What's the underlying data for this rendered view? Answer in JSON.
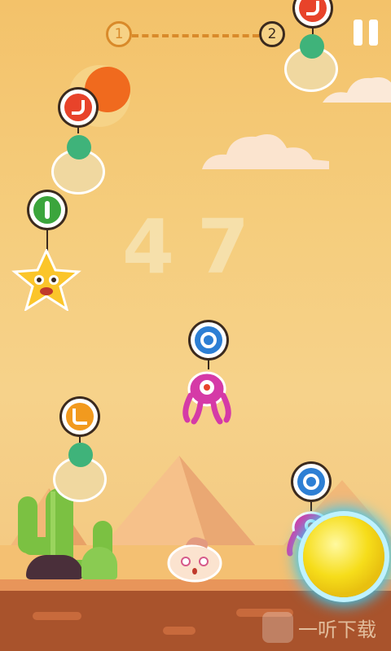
{
  "level_progress": {
    "from": "1",
    "to": "2"
  },
  "score": "47",
  "controls": {
    "pause": "pause"
  },
  "watermark": {
    "text": "一听下载"
  },
  "characters": [
    {
      "name": "frog-egg",
      "gesture_color": "#e8432a"
    },
    {
      "name": "frog-egg",
      "gesture_color": "#e8432a"
    },
    {
      "name": "star",
      "gesture_color": "#3ba53c"
    },
    {
      "name": "pink-monster",
      "gesture_color": "#2d7fd4"
    },
    {
      "name": "frog-egg",
      "gesture_color": "#f29a1e"
    },
    {
      "name": "pink-monster",
      "gesture_color": "#2d7fd4"
    }
  ],
  "colors": {
    "sky": "#f4c874",
    "sun": "#f06a1e",
    "ground": "#a9532c",
    "cactus": "#7bc142",
    "ball": "#f6dd1a"
  }
}
